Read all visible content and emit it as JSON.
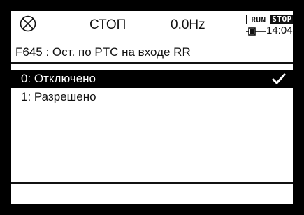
{
  "status": {
    "state": "СТОП",
    "frequency": "0.0Hz",
    "run_badge": "RUN",
    "stop_badge": "STOP",
    "clock": "14:04",
    "mode_icon": "circled-x-icon",
    "battery_icon": "battery-icon"
  },
  "parameter": {
    "line": "F645   : Ост. по PTC на входе RR"
  },
  "options": [
    {
      "label": "0: Отключено",
      "selected": true
    },
    {
      "label": "1: Разрешено",
      "selected": false
    }
  ],
  "colors": {
    "background": "#ffffff",
    "foreground": "#000000",
    "selection": "#000000"
  }
}
